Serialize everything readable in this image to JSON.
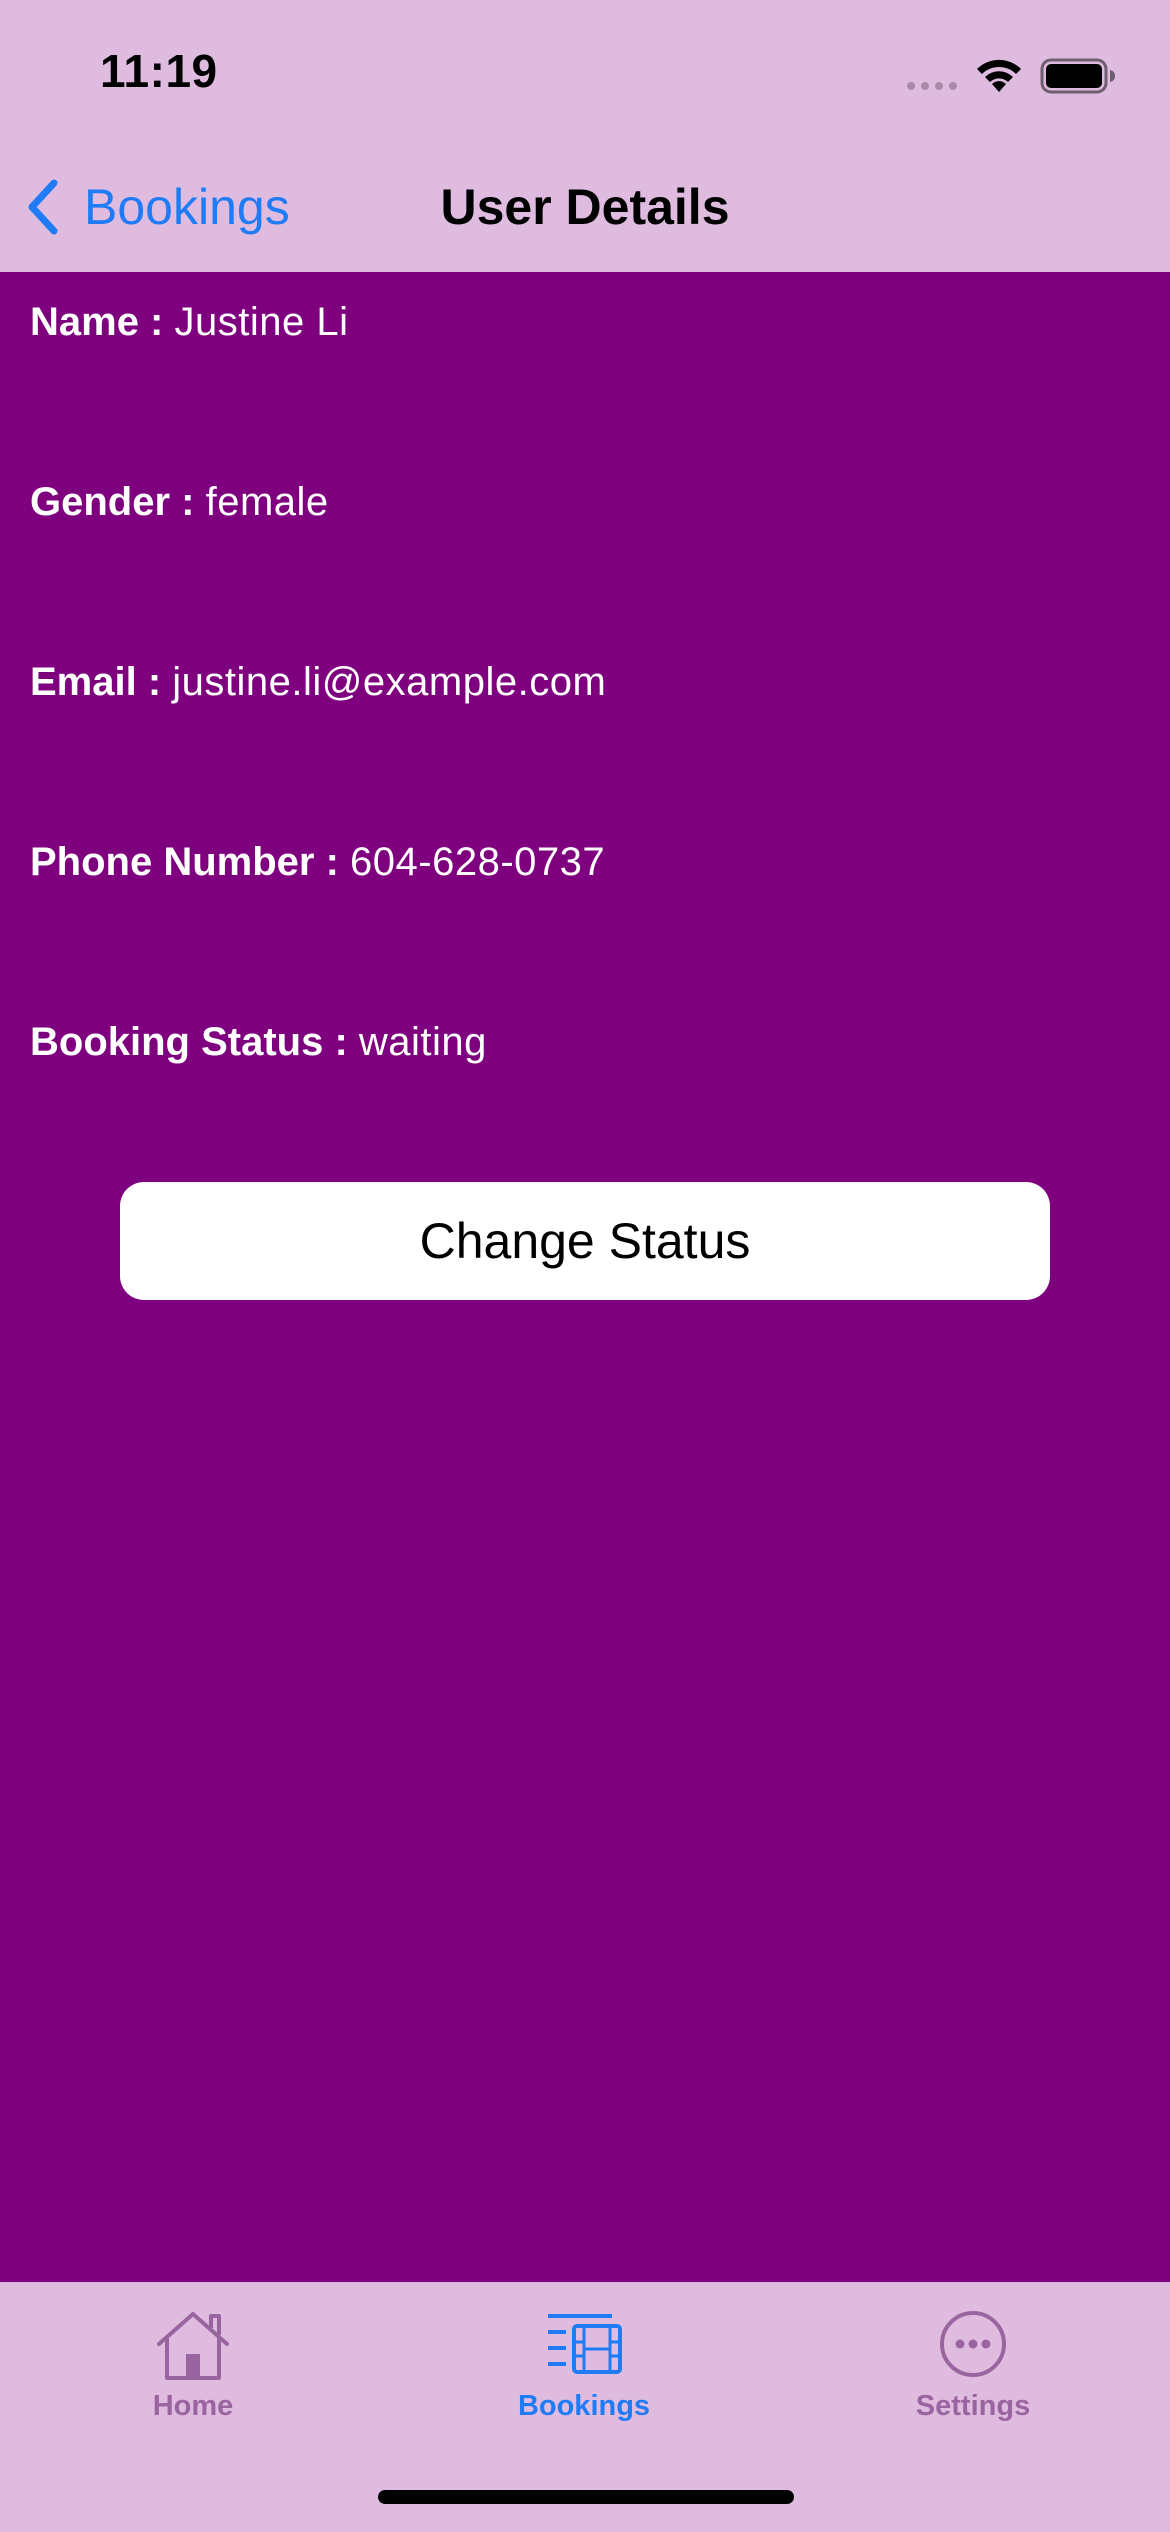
{
  "status_bar": {
    "time": "11:19",
    "icons": [
      "cellular-signal-icon",
      "wifi-icon",
      "battery-icon"
    ]
  },
  "nav": {
    "back_label": "Bookings",
    "title": "User Details"
  },
  "details": {
    "name": {
      "label": "Name :",
      "value": "Justine Li"
    },
    "gender": {
      "label": "Gender :",
      "value": "female"
    },
    "email": {
      "label": "Email :",
      "value": "justine.li@example.com"
    },
    "phone": {
      "label": "Phone Number :",
      "value": "604-628-0737"
    },
    "booking_status": {
      "label": "Booking Status :",
      "value": "waiting"
    }
  },
  "actions": {
    "change_status_label": "Change Status"
  },
  "tab_bar": {
    "tabs": [
      {
        "label": "Home",
        "icon": "house-icon",
        "active": false
      },
      {
        "label": "Bookings",
        "icon": "list-film-icon",
        "active": true
      },
      {
        "label": "Settings",
        "icon": "ellipsis-circle-icon",
        "active": false
      }
    ]
  },
  "colors": {
    "header_background": "#dfbcdf",
    "content_background": "#7f007e",
    "accent": "#1f7cf6",
    "inactive_tab": "#9a64a0",
    "button_background": "#ffffff"
  }
}
